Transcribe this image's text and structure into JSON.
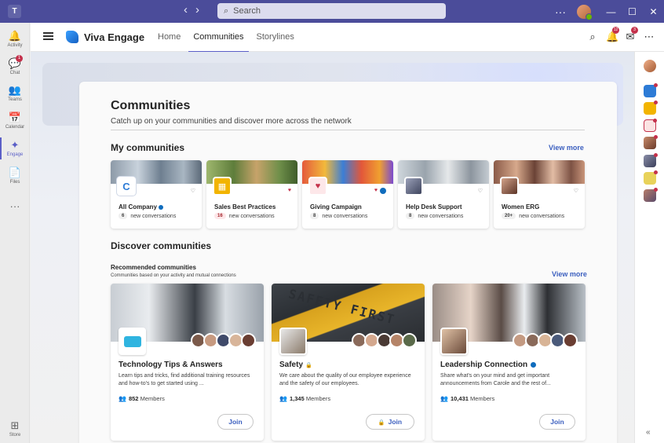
{
  "titlebar": {
    "search_placeholder": "Search",
    "back": "‹",
    "forward": "›",
    "more": "···",
    "minimize": "—",
    "maximize": "☐",
    "close": "✕"
  },
  "rail": [
    {
      "label": "Activity",
      "icon": "🔔",
      "badge": ""
    },
    {
      "label": "Chat",
      "icon": "💬",
      "badge": "1"
    },
    {
      "label": "Teams",
      "icon": "👥",
      "badge": ""
    },
    {
      "label": "Calendar",
      "icon": "📅",
      "badge": ""
    },
    {
      "label": "Engage",
      "icon": "✦",
      "badge": ""
    },
    {
      "label": "Files",
      "icon": "📄",
      "badge": ""
    },
    {
      "label": "",
      "icon": "···",
      "badge": ""
    },
    {
      "label": "Store",
      "icon": "⊞",
      "badge": ""
    }
  ],
  "header": {
    "app_title": "Viva Engage",
    "tabs": [
      "Home",
      "Communities",
      "Storylines"
    ],
    "notif_badge": "12",
    "inbox_badge": "3"
  },
  "page": {
    "title": "Communities",
    "subtitle": "Catch up on your communities and discover more across the network"
  },
  "my_communities": {
    "title": "My communities",
    "view_more": "View more",
    "suffix": "new conversations",
    "cards": [
      {
        "name": "All Company",
        "count": "6",
        "hot": false,
        "favorited": false,
        "verified": true
      },
      {
        "name": "Sales Best Practices",
        "count": "16",
        "hot": true,
        "favorited": true,
        "verified": false
      },
      {
        "name": "Giving Campaign",
        "count": "8",
        "hot": false,
        "favorited": true,
        "verified": false
      },
      {
        "name": "Help Desk Support",
        "count": "8",
        "hot": false,
        "favorited": false,
        "verified": false
      },
      {
        "name": "Women ERG",
        "count": "20+",
        "hot": false,
        "favorited": false,
        "verified": false
      }
    ]
  },
  "discover": {
    "title": "Discover communities",
    "recommended_title": "Recommended communities",
    "recommended_sub": "Communities based on your activity and mutual connections",
    "view_more": "View more",
    "members_suffix": "Members",
    "join_label": "Join",
    "cards": [
      {
        "name": "Technology Tips & Answers",
        "desc": "Learn tips and tricks, find additional training resources and how-to's to get started using ...",
        "members": "852",
        "private": false,
        "verified": false
      },
      {
        "name": "Safety",
        "desc": "We care about the quality of our employee experience and the safety of our employees.",
        "members": "1,345",
        "private": true,
        "verified": false
      },
      {
        "name": "Leadership Connection",
        "desc": "Share what's on your mind and get important announcements from Carole and the rest of...",
        "members": "10,431",
        "private": false,
        "verified": true
      }
    ],
    "cover_text": "SAFETY FIRST"
  },
  "colors": {
    "accent": "#5b5fc7",
    "link": "#3b5fbf",
    "titlebar": "#4b4c9a",
    "badge": "#c4314b"
  }
}
